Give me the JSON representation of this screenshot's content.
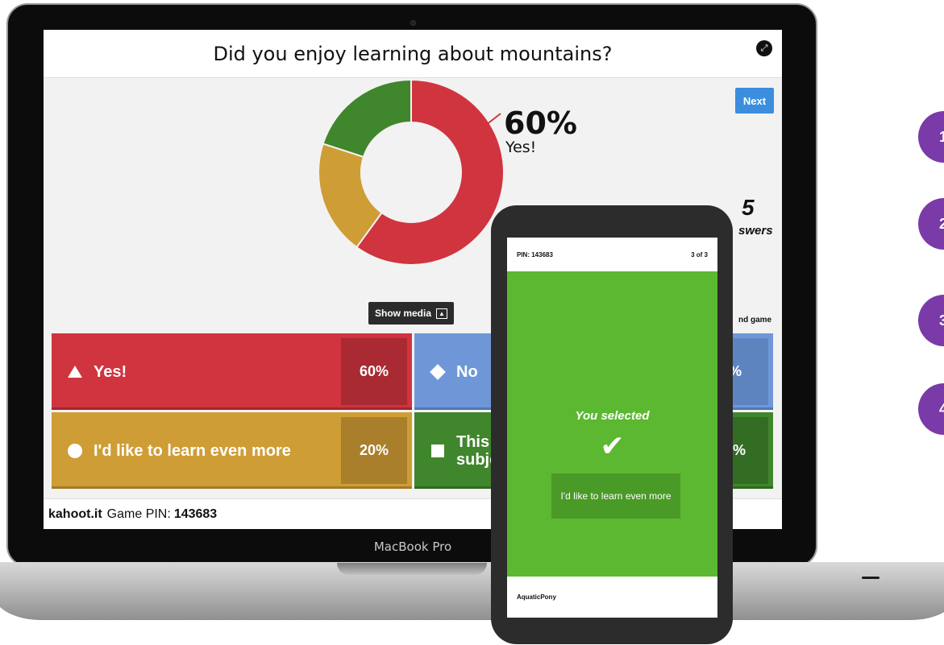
{
  "device": {
    "brand": "MacBook Pro"
  },
  "quiz": {
    "question": "Did you enjoy learning about mountains?",
    "next_label": "Next",
    "highlight": {
      "percent": "60%",
      "label": "Yes!"
    },
    "answers_count": "5",
    "answers_label": "swers",
    "end_game_label": "nd game",
    "show_media_label": "Show media",
    "options": [
      {
        "label": "Yes!",
        "percent": "60%",
        "shape": "triangle-icon",
        "color": "#d0343f"
      },
      {
        "label": "No",
        "percent": "%",
        "shape": "diamond-icon",
        "color": "#6f97d8"
      },
      {
        "label": "I'd like to learn even more",
        "percent": "20%",
        "shape": "circle-icon",
        "color": "#cf9d35"
      },
      {
        "label_line1": "This w",
        "label_line2": "subje",
        "percent": "0%",
        "shape": "square-icon",
        "color": "#3f862c"
      }
    ]
  },
  "chart_data": {
    "type": "pie",
    "categories": [
      "Yes!",
      "I'd like to learn even more",
      "This w... subje..."
    ],
    "values": [
      60,
      20,
      20
    ],
    "colors": [
      "#d0343f",
      "#cf9d35",
      "#3f862c"
    ],
    "title": "",
    "xlabel": "",
    "ylabel": ""
  },
  "footer": {
    "site": "kahoot.it",
    "pin_label": "Game PIN:",
    "pin": "143683"
  },
  "phone": {
    "pin": "PIN: 143683",
    "progress": "3 of 3",
    "selected_label": "You selected",
    "selected_answer": "I'd like to learn even more",
    "nickname": "AquaticPony"
  }
}
